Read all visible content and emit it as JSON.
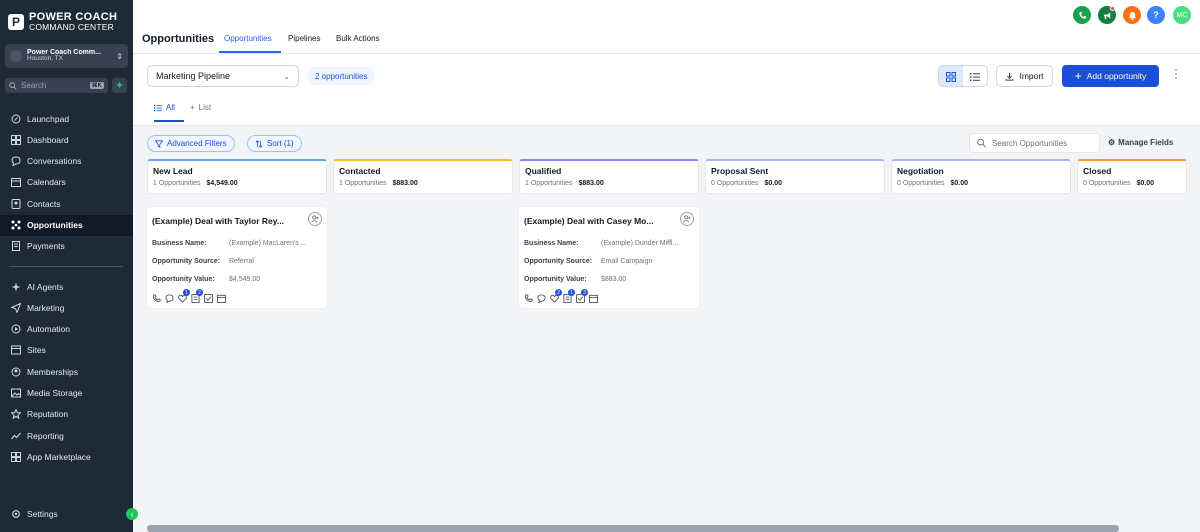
{
  "brand": {
    "title": "POWER COACH",
    "subtitle": "COMMAND CENTER",
    "mark": "P"
  },
  "account": {
    "name": "Power Coach Comm...",
    "location": "Houston, TX"
  },
  "sidebar_search": {
    "placeholder": "Search",
    "shortcut": "⌘K"
  },
  "nav": {
    "items": [
      {
        "label": "Launchpad",
        "icon": "launchpad-icon"
      },
      {
        "label": "Dashboard",
        "icon": "dashboard-icon"
      },
      {
        "label": "Conversations",
        "icon": "chat-icon"
      },
      {
        "label": "Calendars",
        "icon": "calendar-icon"
      },
      {
        "label": "Contacts",
        "icon": "contacts-icon"
      },
      {
        "label": "Opportunities",
        "icon": "opportunities-icon",
        "active": true
      },
      {
        "label": "Payments",
        "icon": "payments-icon"
      }
    ],
    "items2": [
      {
        "label": "AI Agents",
        "icon": "ai-agents-icon"
      },
      {
        "label": "Marketing",
        "icon": "send-icon"
      },
      {
        "label": "Automation",
        "icon": "automation-icon"
      },
      {
        "label": "Sites",
        "icon": "sites-icon"
      },
      {
        "label": "Memberships",
        "icon": "memberships-icon"
      },
      {
        "label": "Media Storage",
        "icon": "media-icon"
      },
      {
        "label": "Reputation",
        "icon": "star-icon"
      },
      {
        "label": "Reporting",
        "icon": "reporting-icon"
      },
      {
        "label": "App Marketplace",
        "icon": "marketplace-icon"
      }
    ],
    "settings": "Settings"
  },
  "header": {
    "title": "Opportunities",
    "tabs": [
      "Opportunities",
      "Pipelines",
      "Bulk Actions"
    ],
    "active_tab": "Opportunities",
    "avatar_initials": "MC",
    "colors": {
      "phone": "#16a34a",
      "megaphone": "#15803d",
      "bell": "#f97316",
      "help": "#3b82f6",
      "avatar": "#4ade80"
    }
  },
  "toolbar": {
    "pipeline": "Marketing Pipeline",
    "count": "2 opportunities",
    "import": "Import",
    "add": "Add opportunity"
  },
  "subtabs": {
    "all": "All",
    "list": "List"
  },
  "filters": {
    "advanced": "Advanced Filters",
    "sort": "Sort (1)",
    "search_placeholder": "Search Opportunities",
    "manage_fields": "Manage Fields"
  },
  "stages": [
    {
      "name": "New Lead",
      "count": "1 Opportunities",
      "amount": "$4,549.00",
      "color": "#60a5fa"
    },
    {
      "name": "Contacted",
      "count": "1 Opportunities",
      "amount": "$883.00",
      "color": "#fbbf24"
    },
    {
      "name": "Qualified",
      "count": "1 Opportunities",
      "amount": "$883.00",
      "color": "#818cf8"
    },
    {
      "name": "Proposal Sent",
      "count": "0 Opportunities",
      "amount": "$0.00",
      "color": "#a5b4fc"
    },
    {
      "name": "Negotiation",
      "count": "0 Opportunities",
      "amount": "$0.00",
      "color": "#a5b4fc"
    },
    {
      "name": "Closed",
      "count": "0 Opportunities",
      "amount": "$0.00",
      "color": "#fb923c"
    }
  ],
  "cards": [
    {
      "title": "(Example) Deal with Taylor Rey...",
      "labels": [
        "Business Name:",
        "Opportunity Source:",
        "Opportunity Value:"
      ],
      "values": [
        "(Example) MacLaren's ...",
        "Referral",
        "$4,549.00"
      ],
      "badges": [
        "1",
        "2"
      ]
    },
    {
      "title": "(Example) Deal with Casey Mo...",
      "labels": [
        "Business Name:",
        "Opportunity Source:",
        "Opportunity Value:"
      ],
      "values": [
        "(Example) Dunder Miffl...",
        "Email Campaign",
        "$883.00"
      ],
      "badges": [
        "2",
        "1",
        "3"
      ]
    }
  ]
}
